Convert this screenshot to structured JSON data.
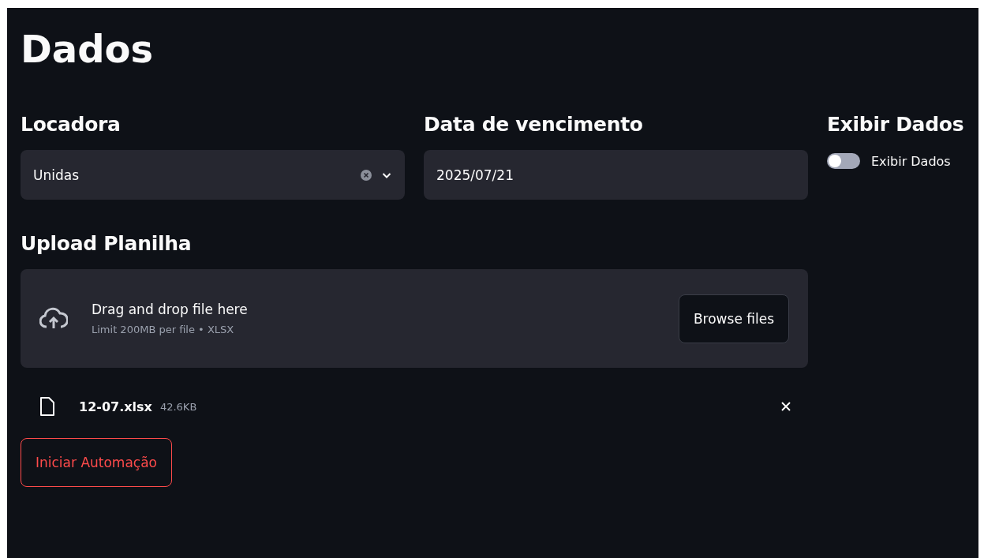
{
  "title": "Dados",
  "locadora": {
    "label": "Locadora",
    "value": "Unidas"
  },
  "data_vencimento": {
    "label": "Data de vencimento",
    "value": "2025/07/21"
  },
  "exibir_dados": {
    "label": "Exibir Dados",
    "toggle_label": "Exibir Dados",
    "on": false
  },
  "upload": {
    "label": "Upload Planilha",
    "drop_text": "Drag and drop file here",
    "limit_text": "Limit 200MB per file • XLSX",
    "browse_button": "Browse files",
    "files": [
      {
        "name": "12-07.xlsx",
        "size": "42.6KB"
      }
    ]
  },
  "action_button": "Iniciar Automação"
}
